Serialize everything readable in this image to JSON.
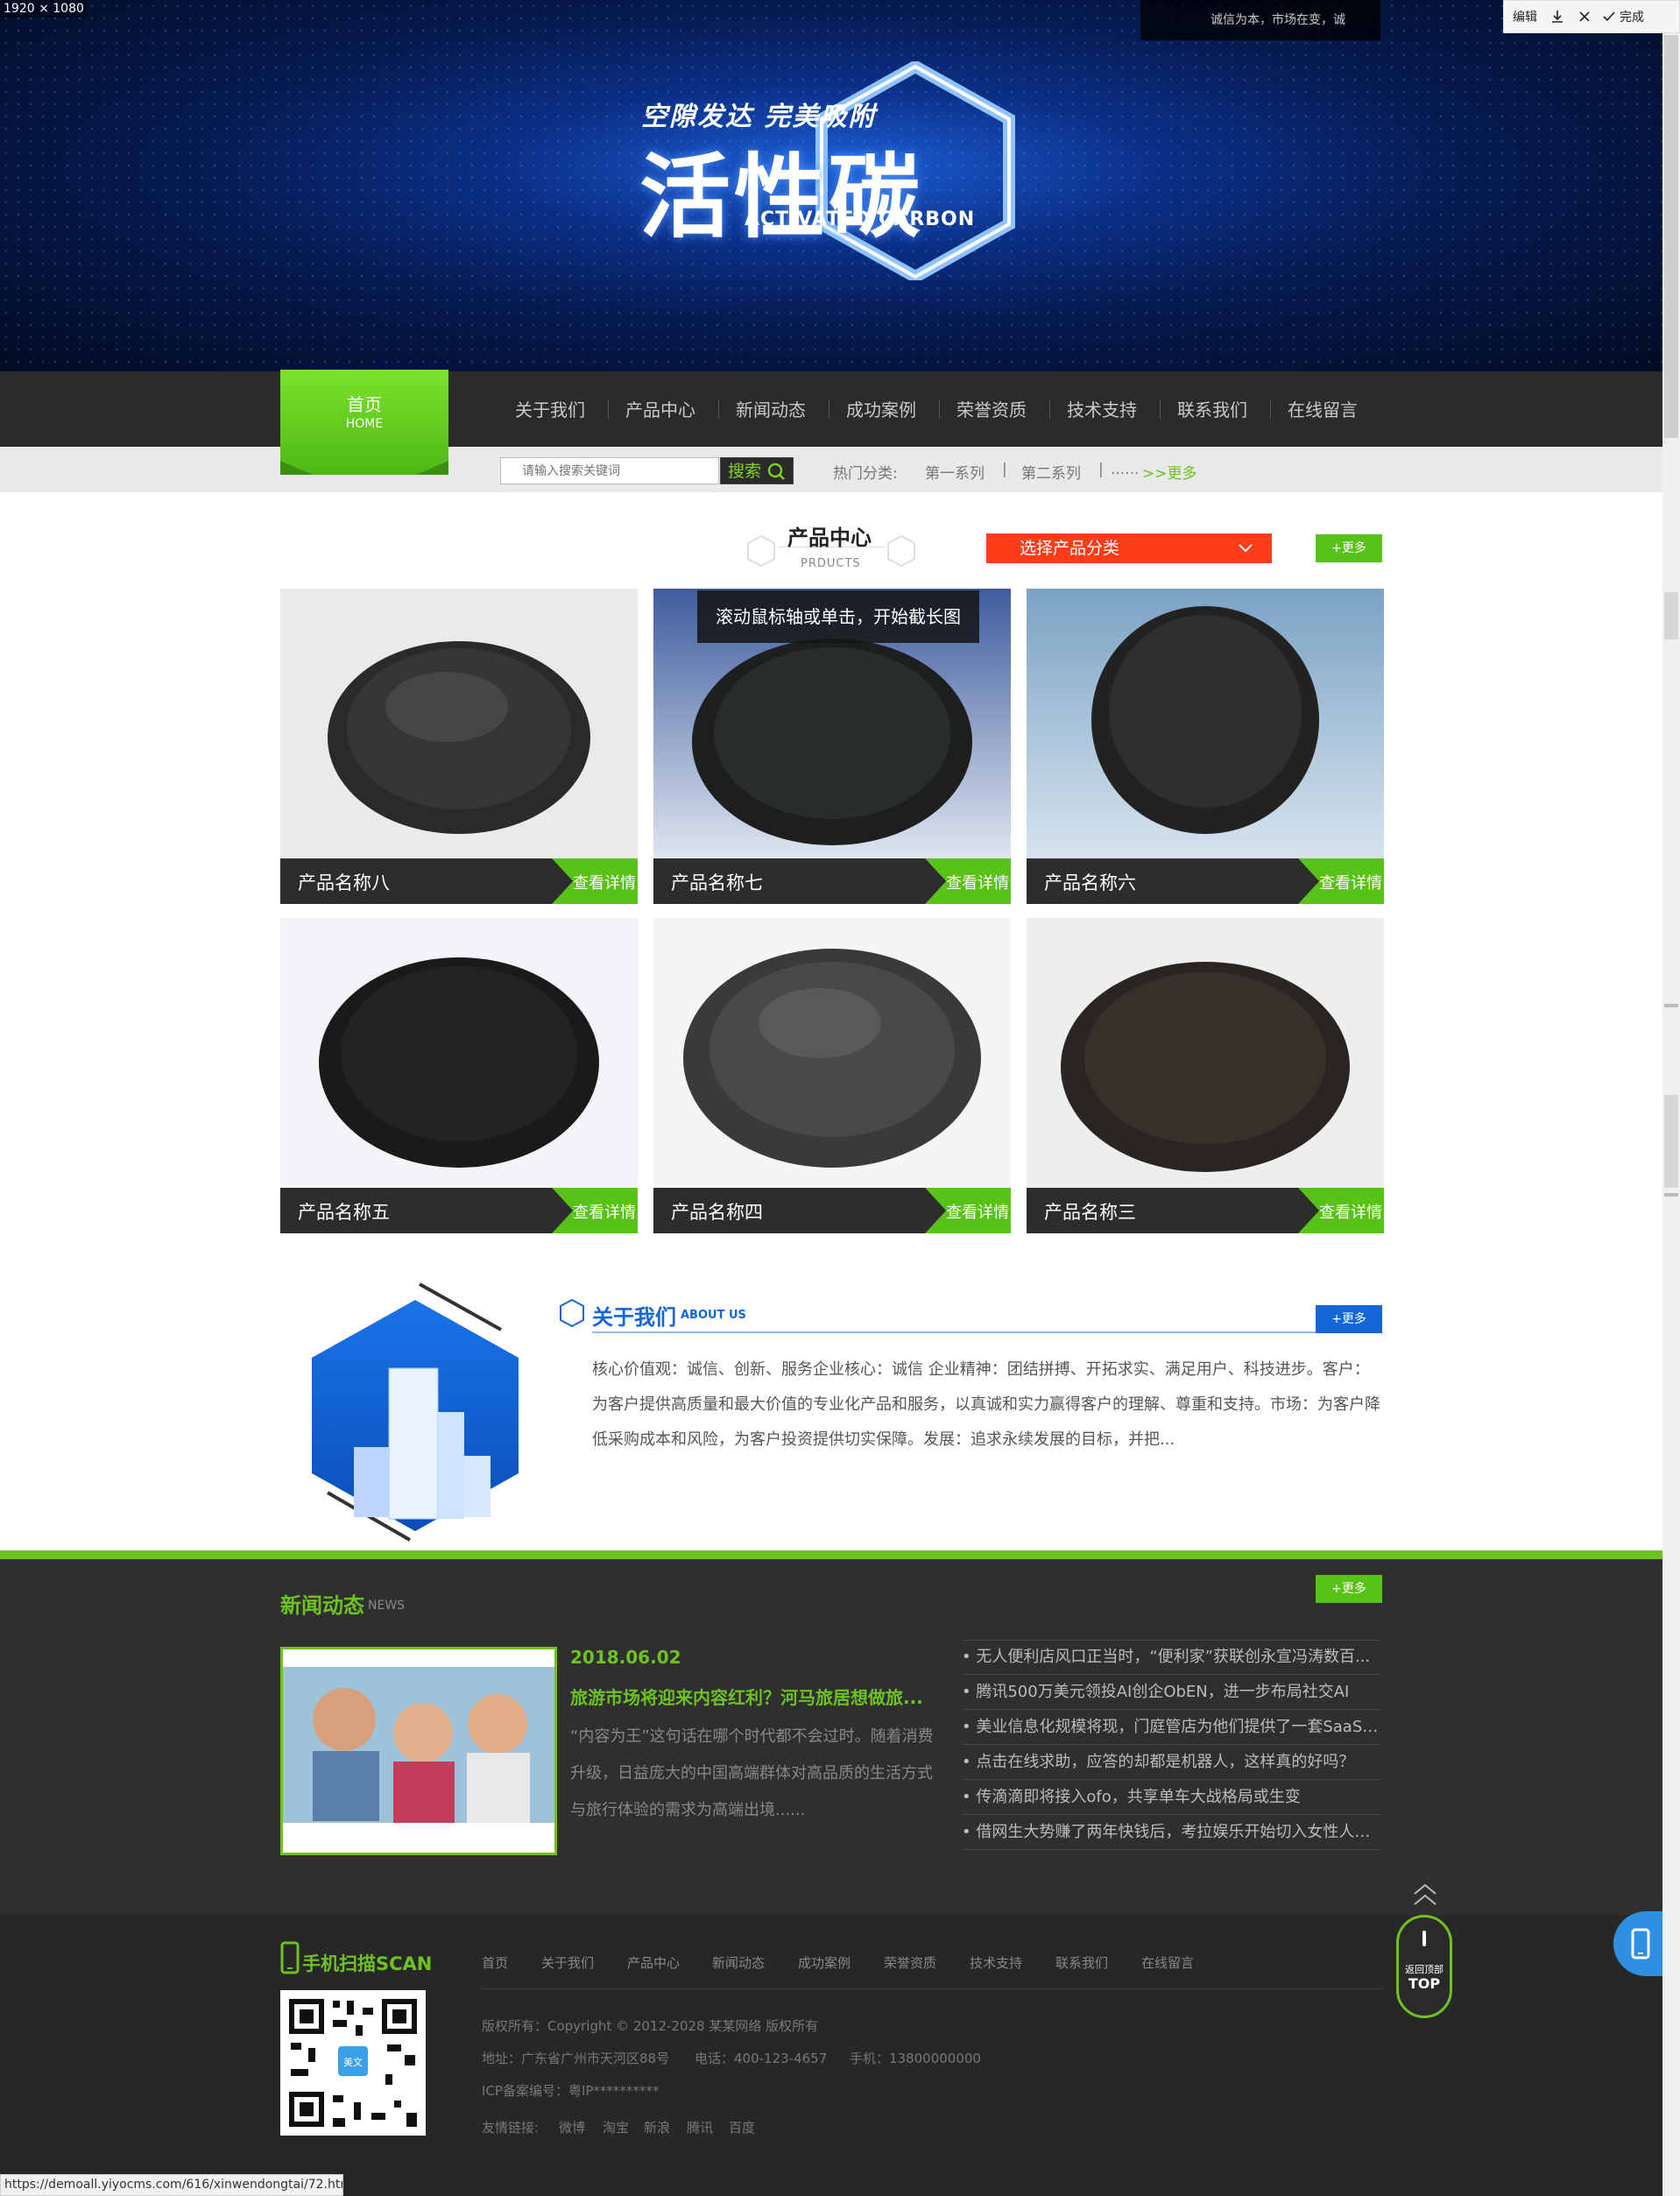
{
  "screenshot_label": "1920 × 1080",
  "ticker_text": "诚信为本，市场在变，诚",
  "toolbar": {
    "edit": "编辑",
    "download_icon": "download-icon",
    "close_icon": "close-icon",
    "done": "完成"
  },
  "banner": {
    "subtitle": "空隙发达 完美吸附",
    "title": "活性碳",
    "english": "ACTIVATED CARBON"
  },
  "nav": {
    "home": {
      "title": "首页",
      "sub": "HOME"
    },
    "items": [
      "关于我们",
      "产品中心",
      "新闻动态",
      "成功案例",
      "荣誉资质",
      "技术支持",
      "联系我们",
      "在线留言"
    ]
  },
  "search": {
    "placeholder": "请输入搜索关键词",
    "button": "搜索",
    "hot_label": "热门分类:",
    "hot_items": [
      "第一系列",
      "|",
      "第二系列",
      "|",
      "......"
    ],
    "more": ">>更多"
  },
  "products": {
    "title": "产品中心",
    "subtitle": "PRDUCTS",
    "category_select": "选择产品分类",
    "more": "+更多",
    "detail_label": "查看详情",
    "items": [
      {
        "name": "产品名称八"
      },
      {
        "name": "产品名称七"
      },
      {
        "name": "产品名称六"
      },
      {
        "name": "产品名称五"
      },
      {
        "name": "产品名称四"
      },
      {
        "name": "产品名称三"
      }
    ],
    "tooltip": "滚动鼠标轴或单击，开始截长图"
  },
  "about": {
    "title": "关于我们",
    "english": "ABOUT US",
    "more": "+更多",
    "text": "核心价值观：诚信、创新、服务企业核心：诚信 企业精神：团结拼搏、开拓求实、满足用户、科技进步。客户：为客户提供高质量和最大价值的专业化产品和服务，以真诚和实力赢得客户的理解、尊重和支持。市场：为客户降低采购成本和风险，为客户投资提供切实保障。发展：追求永续发展的目标，并把..."
  },
  "news": {
    "title": "新闻动态",
    "english": "NEWS",
    "more": "+更多",
    "featured": {
      "date": "2018.06.02",
      "headline": "旅游市场将迎来内容红利？河马旅居想做旅...",
      "summary": "“内容为王”这句话在哪个时代都不会过时。随着消费升级，日益庞大的中国高端群体对高品质的生活方式与旅行体验的需求为高端出境......"
    },
    "list": [
      "• 无人便利店风口正当时，“便利家”获联创永宣冯涛数百...",
      "• 腾讯500万美元领投AI创企ObEN，进一步布局社交AI",
      "• 美业信息化规模将现，门庭管店为他们提供了一套SaaS管...",
      "• 点击在线求助，应答的却都是机器人，这样真的好吗？",
      "• 传滴滴即将接入ofo，共享单车大战格局或生变",
      "• 借网生大势赚了两年快钱后，考拉娱乐开始切入女性人群..."
    ]
  },
  "footer": {
    "scan_title": "手机扫描SCAN",
    "qr_center": "美文",
    "nav": [
      "首页",
      "关于我们",
      "产品中心",
      "新闻动态",
      "成功案例",
      "荣誉资质",
      "技术支持",
      "联系我们",
      "在线留言"
    ],
    "copyright": "版权所有：Copyright © 2012-2028 某某网络 版权所有",
    "address": "地址：广东省广州市天河区88号",
    "phone": "电话：400-123-4657",
    "mobile": "手机：13800000000",
    "icp": "ICP备案编号：粤IP**********",
    "links_label": "友情链接:",
    "links": [
      "微博",
      "淘宝",
      "新浪",
      "腾讯",
      "百度"
    ]
  },
  "totop": {
    "line1": "返回顶部",
    "line2": "TOP"
  },
  "status_url": "https://demoall.yiyocms.com/616/xinwendongtai/72.html",
  "colors": {
    "green": "#6ec21f",
    "blue": "#1467d8",
    "red": "#ff3c1a",
    "dark": "#2b2b2b"
  }
}
